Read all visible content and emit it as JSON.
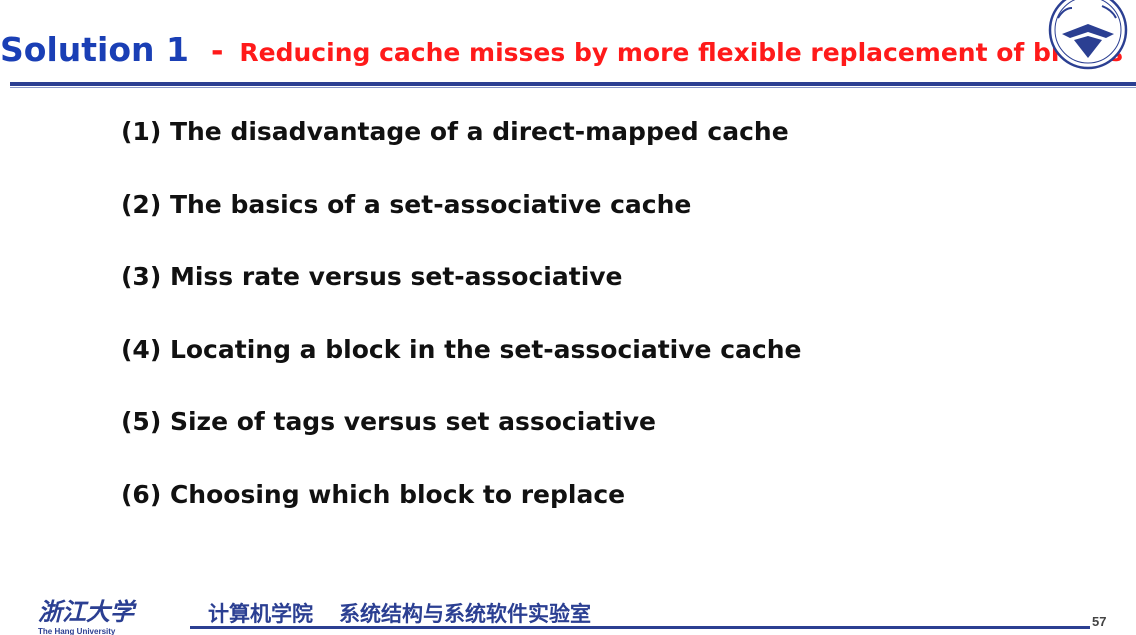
{
  "slide": {
    "title_main": "Solution 1",
    "title_dash": "-",
    "title_sub": "Reducing cache misses by more flexible replacement of blocks",
    "items": [
      "(1) The disadvantage of a direct-mapped cache",
      "(2) The basics of a set-associative cache",
      "(3) Miss rate versus set-associative",
      "(4) Locating a block in the set-associative cache",
      "(5) Size of tags versus set associative",
      "(6) Choosing which block to replace"
    ]
  },
  "footer": {
    "logo_text": "浙江大学",
    "logo_subtext": "The Hang University",
    "college": "计算机学院",
    "lab": "系统结构与系统软件实验室",
    "page_number": "57"
  },
  "colors": {
    "title_blue": "#1a3fb5",
    "title_red": "#ff1a1a",
    "rule_blue": "#2b3f92"
  },
  "icons": {
    "seal": "zju-seal-icon"
  }
}
